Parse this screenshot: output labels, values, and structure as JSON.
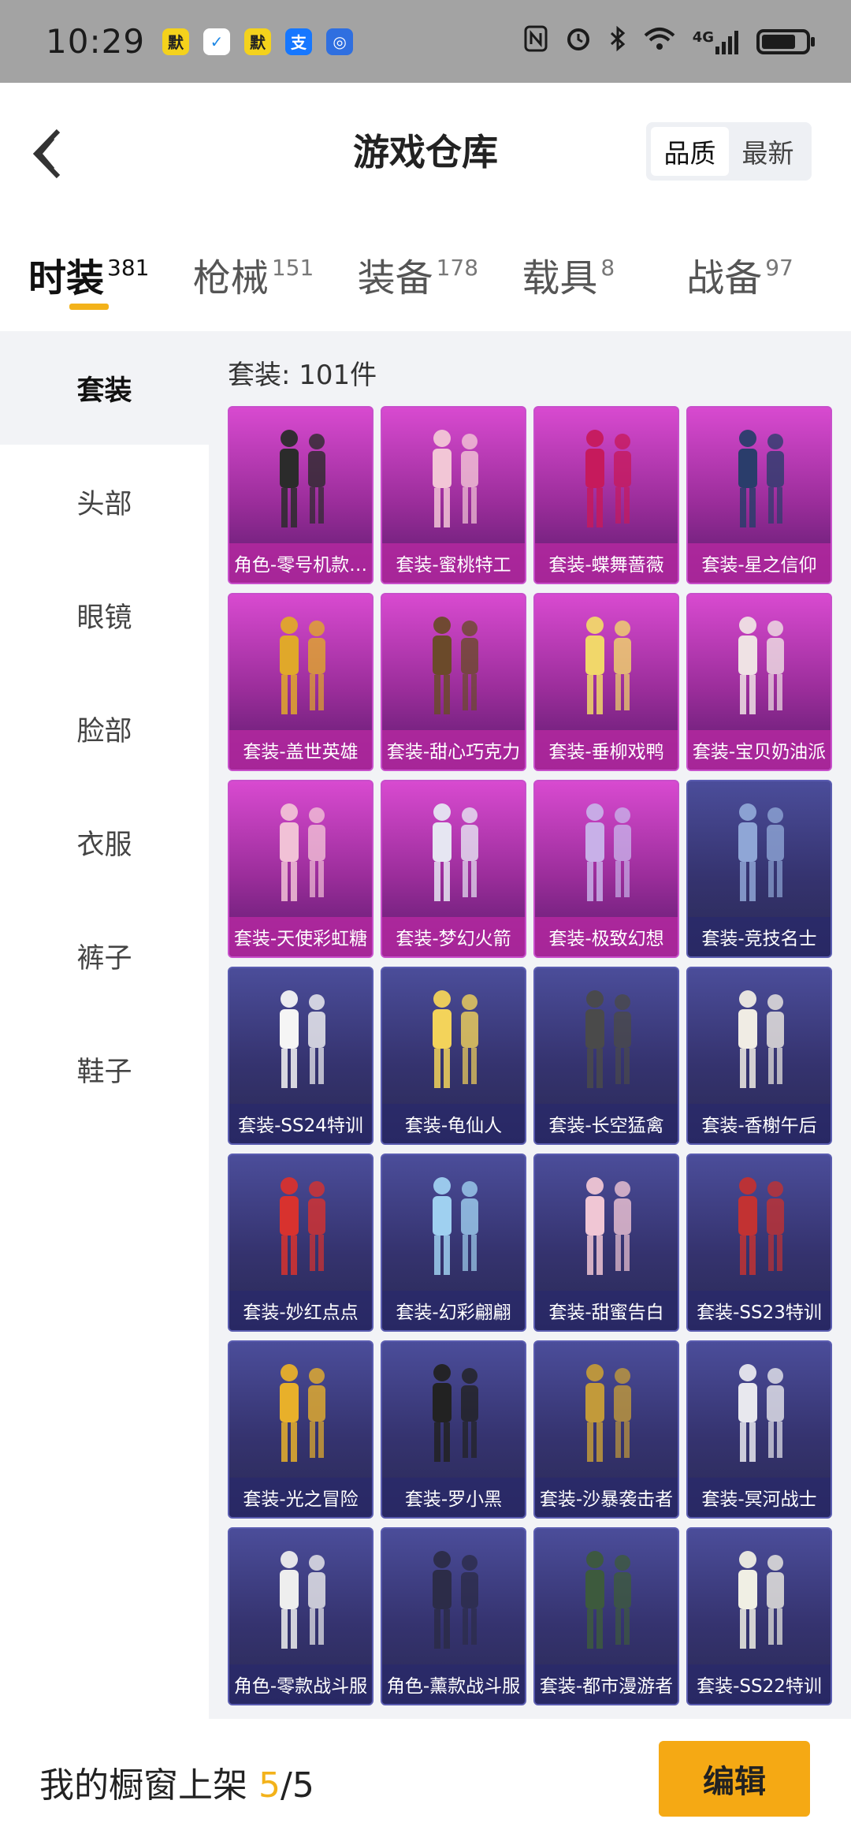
{
  "status_bar": {
    "time": "10:29",
    "apps": [
      {
        "name": "app-icon-1",
        "glyph": "默",
        "bg": "#f4d21c",
        "fg": "#222"
      },
      {
        "name": "shield-icon",
        "glyph": "✓",
        "bg": "#ffffff",
        "fg": "#1e88e5"
      },
      {
        "name": "app-icon-3",
        "glyph": "默",
        "bg": "#f4d21c",
        "fg": "#222"
      },
      {
        "name": "alipay-icon",
        "glyph": "支",
        "bg": "#1677ff",
        "fg": "#ffffff"
      },
      {
        "name": "app-icon-5",
        "glyph": "◎",
        "bg": "#2f6fe0",
        "fg": "#ffffff"
      }
    ],
    "network": "4G",
    "battery_level": 0.78
  },
  "header": {
    "title": "游戏仓库",
    "sort_quality": "品质",
    "sort_latest": "最新"
  },
  "tabs": [
    {
      "label": "时装",
      "count": "381",
      "active": true
    },
    {
      "label": "枪械",
      "count": "151",
      "active": false
    },
    {
      "label": "装备",
      "count": "178",
      "active": false
    },
    {
      "label": "载具",
      "count": "8",
      "active": false
    },
    {
      "label": "战备",
      "count": "97",
      "active": false
    }
  ],
  "sidebar": {
    "items": [
      "套装",
      "头部",
      "眼镜",
      "脸部",
      "衣服",
      "裤子",
      "鞋子"
    ]
  },
  "content": {
    "count_label": "套装: 101件"
  },
  "items": [
    {
      "label": "角色-零号机款…",
      "tier": "purple"
    },
    {
      "label": "套装-蜜桃特工",
      "tier": "purple"
    },
    {
      "label": "套装-蝶舞蔷薇",
      "tier": "purple"
    },
    {
      "label": "套装-星之信仰",
      "tier": "purple"
    },
    {
      "label": "套装-盖世英雄",
      "tier": "purple"
    },
    {
      "label": "套装-甜心巧克力",
      "tier": "purple"
    },
    {
      "label": "套装-垂柳戏鸭",
      "tier": "purple"
    },
    {
      "label": "套装-宝贝奶油派",
      "tier": "purple"
    },
    {
      "label": "套装-天使彩虹糖",
      "tier": "purple"
    },
    {
      "label": "套装-梦幻火箭",
      "tier": "purple"
    },
    {
      "label": "套装-极致幻想",
      "tier": "purple"
    },
    {
      "label": "套装-竞技名士",
      "tier": "blue"
    },
    {
      "label": "套装-SS24特训",
      "tier": "blue"
    },
    {
      "label": "套装-龟仙人",
      "tier": "blue"
    },
    {
      "label": "套装-长空猛禽",
      "tier": "blue"
    },
    {
      "label": "套装-香榭午后",
      "tier": "blue"
    },
    {
      "label": "套装-妙红点点",
      "tier": "blue"
    },
    {
      "label": "套装-幻彩翩翩",
      "tier": "blue"
    },
    {
      "label": "套装-甜蜜告白",
      "tier": "blue"
    },
    {
      "label": "套装-SS23特训",
      "tier": "blue"
    },
    {
      "label": "套装-光之冒险",
      "tier": "blue"
    },
    {
      "label": "套装-罗小黑",
      "tier": "blue"
    },
    {
      "label": "套装-沙暴袭击者",
      "tier": "blue"
    },
    {
      "label": "套装-冥河战士",
      "tier": "blue"
    },
    {
      "label": "角色-零款战斗服",
      "tier": "blue"
    },
    {
      "label": "角色-薰款战斗服",
      "tier": "blue"
    },
    {
      "label": "套装-都市漫游者",
      "tier": "blue"
    },
    {
      "label": "套装-SS22特训",
      "tier": "blue"
    }
  ],
  "bottom": {
    "label": "我的橱窗上架",
    "current": "5",
    "total": "/5",
    "edit_label": "编辑"
  }
}
